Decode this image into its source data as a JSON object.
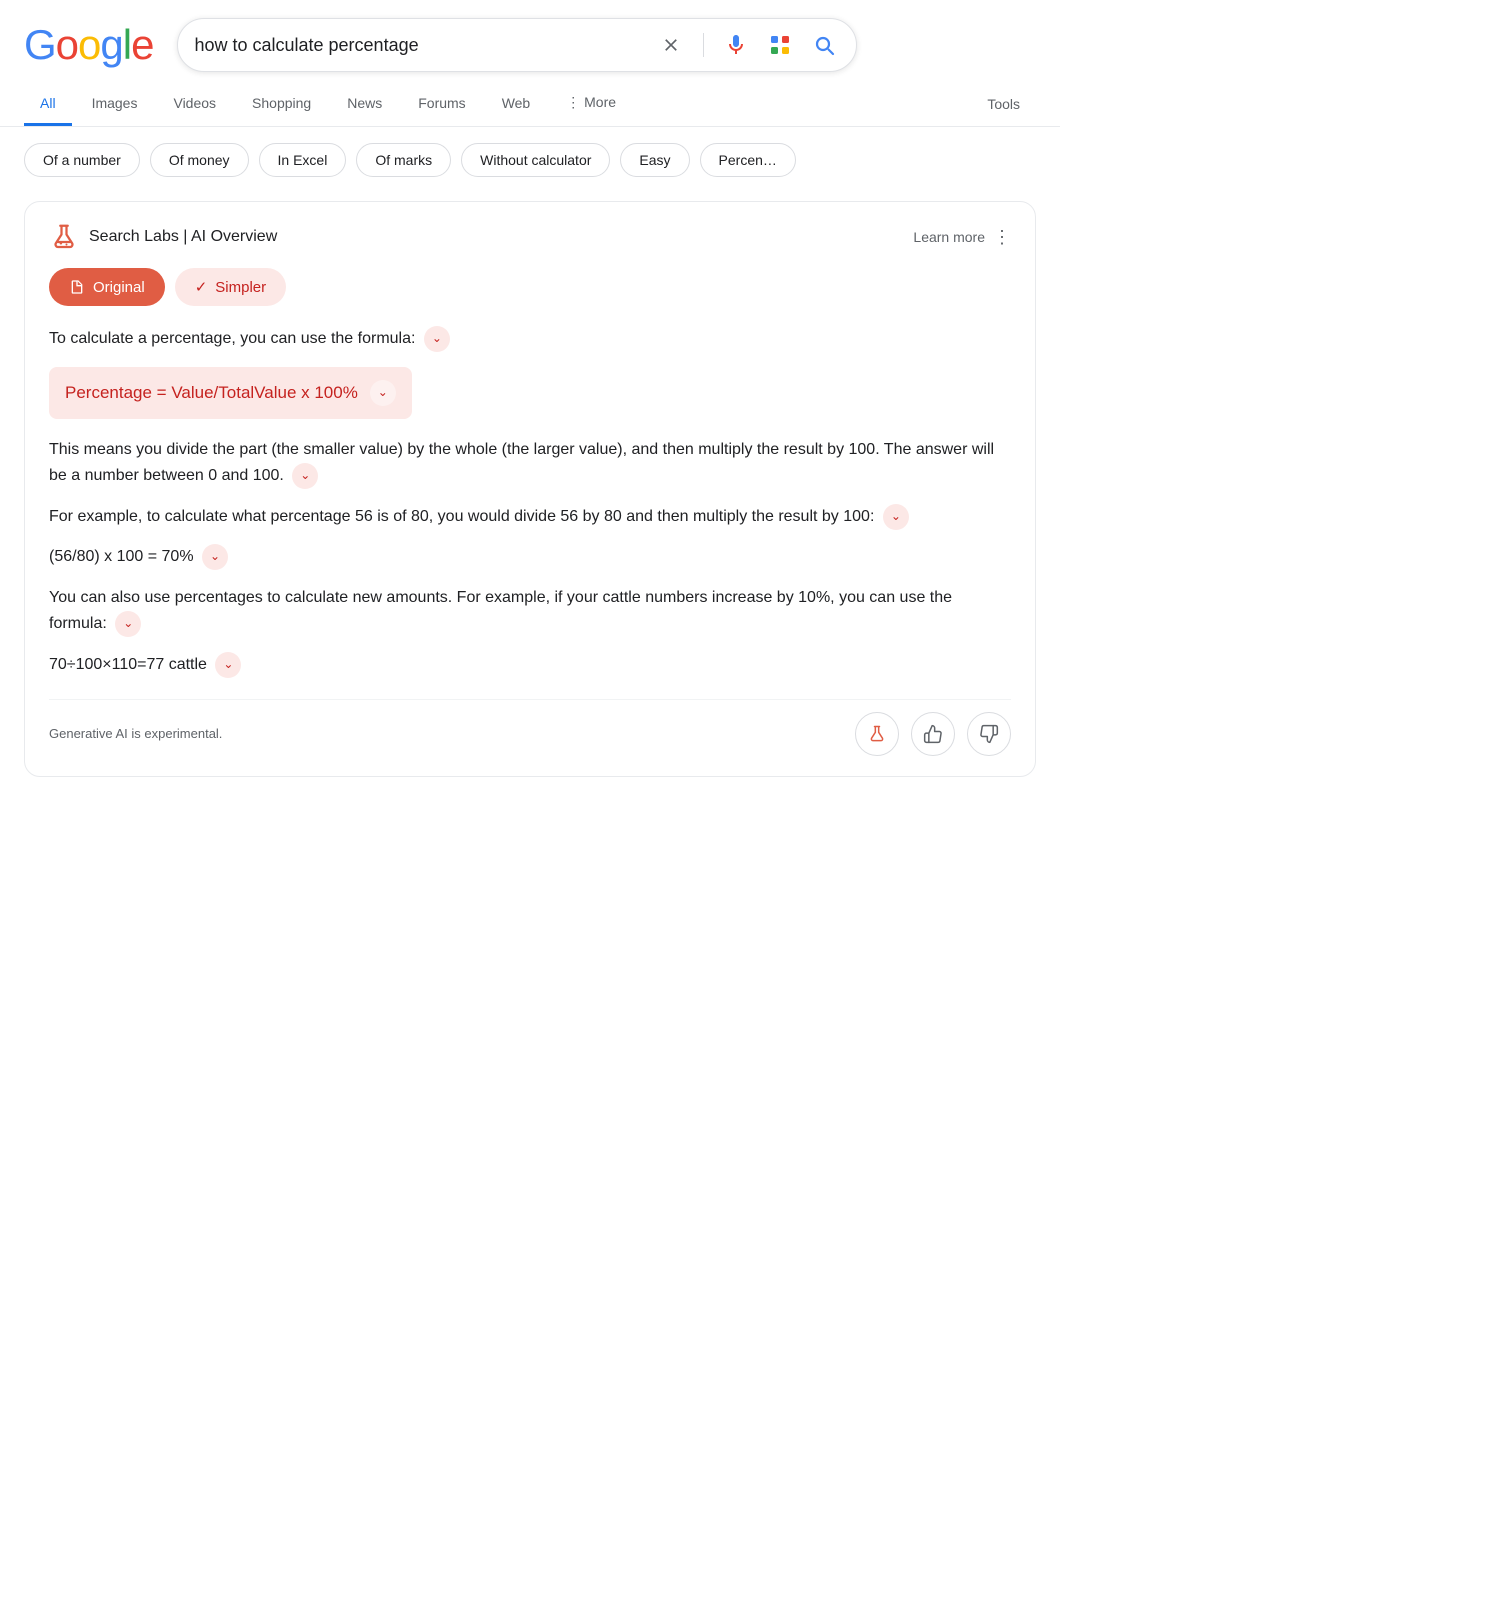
{
  "header": {
    "logo_letters": [
      {
        "char": "G",
        "class": "g-blue"
      },
      {
        "char": "o",
        "class": "g-red"
      },
      {
        "char": "o",
        "class": "g-yellow"
      },
      {
        "char": "g",
        "class": "g-blue"
      },
      {
        "char": "l",
        "class": "g-green"
      },
      {
        "char": "e",
        "class": "g-red"
      }
    ],
    "search_value": "how to calculate percentage",
    "search_placeholder": "Search"
  },
  "nav": {
    "tabs": [
      {
        "label": "All",
        "active": true
      },
      {
        "label": "Images",
        "active": false
      },
      {
        "label": "Videos",
        "active": false
      },
      {
        "label": "Shopping",
        "active": false
      },
      {
        "label": "News",
        "active": false
      },
      {
        "label": "Forums",
        "active": false
      },
      {
        "label": "Web",
        "active": false
      },
      {
        "label": "More",
        "active": false
      }
    ],
    "tools_label": "Tools"
  },
  "chips": {
    "items": [
      {
        "label": "Of a number"
      },
      {
        "label": "Of money"
      },
      {
        "label": "In Excel"
      },
      {
        "label": "Of marks"
      },
      {
        "label": "Without calculator"
      },
      {
        "label": "Easy"
      },
      {
        "label": "Percen..."
      }
    ]
  },
  "ai_overview": {
    "icon_label": "flask-icon",
    "title": "Search Labs | AI Overview",
    "learn_more": "Learn more",
    "mode_original": "Original",
    "mode_simpler": "Simpler",
    "paragraph1": "To calculate a percentage, you can use the formula:",
    "formula": "Percentage = Value/TotalValue x 100%",
    "paragraph2": "This means you divide the part (the smaller value) by the whole (the larger value), and then multiply the result by 100. The answer will be a number between 0 and 100.",
    "paragraph3": "For example, to calculate what percentage 56 is of 80, you would divide 56 by 80 and then multiply the result by 100:",
    "example1": "(56/80) x 100 = 70%",
    "paragraph4": "You can also use percentages to calculate new amounts. For example, if your cattle numbers increase by 10%, you can use the formula:",
    "example2": "70÷100×110=77 cattle",
    "footer_text": "Generative AI is experimental.",
    "feedback": {
      "flask_label": "flask-feedback-icon",
      "thumbup_label": "thumbs-up-icon",
      "thumbdown_label": "thumbs-down-icon"
    }
  }
}
